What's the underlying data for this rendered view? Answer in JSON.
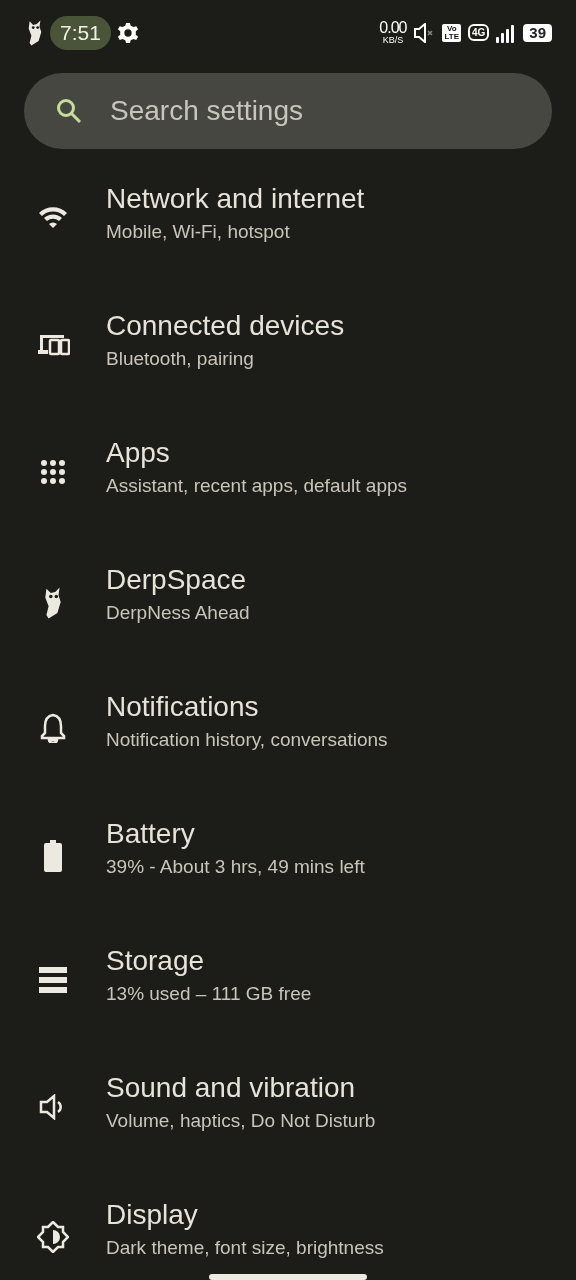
{
  "status_bar": {
    "time": "7:51",
    "speed": "0.00",
    "speed_unit": "KB/S",
    "volte_top": "Vo",
    "volte_bottom": "LTE",
    "network": "4G",
    "battery": "39"
  },
  "search": {
    "placeholder": "Search settings"
  },
  "items": [
    {
      "title": "Network and internet",
      "subtitle": "Mobile, Wi-Fi, hotspot"
    },
    {
      "title": "Connected devices",
      "subtitle": "Bluetooth, pairing"
    },
    {
      "title": "Apps",
      "subtitle": "Assistant, recent apps, default apps"
    },
    {
      "title": "DerpSpace",
      "subtitle": "DerpNess Ahead"
    },
    {
      "title": "Notifications",
      "subtitle": "Notification history, conversations"
    },
    {
      "title": "Battery",
      "subtitle": "39% - About 3 hrs, 49 mins left"
    },
    {
      "title": "Storage",
      "subtitle": "13% used – 111 GB free"
    },
    {
      "title": "Sound and vibration",
      "subtitle": "Volume, haptics, Do Not Disturb"
    },
    {
      "title": "Display",
      "subtitle": "Dark theme, font size, brightness"
    }
  ]
}
